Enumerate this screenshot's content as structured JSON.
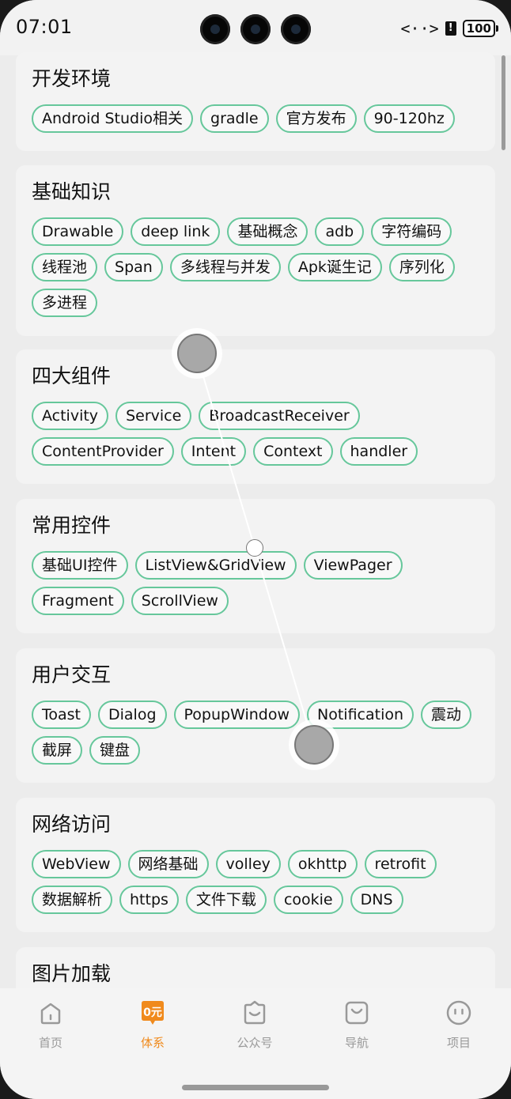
{
  "status_bar": {
    "time": "07:01",
    "battery": "100",
    "code_glyph": "<··>",
    "sim_glyph": "!"
  },
  "sections": [
    {
      "title": "开发环境",
      "tags": [
        "Android Studio相关",
        "gradle",
        "官方发布",
        "90-120hz"
      ]
    },
    {
      "title": "基础知识",
      "tags": [
        "Drawable",
        "deep link",
        "基础概念",
        "adb",
        "字符编码",
        "线程池",
        "Span",
        "多线程与并发",
        "Apk诞生记",
        "序列化",
        "多进程"
      ]
    },
    {
      "title": "四大组件",
      "tags": [
        "Activity",
        "Service",
        "BroadcastReceiver",
        "ContentProvider",
        "Intent",
        "Context",
        "handler"
      ]
    },
    {
      "title": "常用控件",
      "tags": [
        "基础UI控件",
        "ListView&GridView",
        "ViewPager",
        "Fragment",
        "ScrollView"
      ]
    },
    {
      "title": "用户交互",
      "tags": [
        "Toast",
        "Dialog",
        "PopupWindow",
        "Notification",
        "震动",
        "截屏",
        "键盘"
      ]
    },
    {
      "title": "网络访问",
      "tags": [
        "WebView",
        "网络基础",
        "volley",
        "okhttp",
        "retrofit",
        "数据解析",
        "https",
        "文件下载",
        "cookie",
        "DNS"
      ]
    },
    {
      "title": "图片加载",
      "tags": []
    }
  ],
  "nav": {
    "items": [
      {
        "label": "首页",
        "icon": "home-icon",
        "active": false
      },
      {
        "label": "体系",
        "icon": "system-icon",
        "active": true,
        "badge": "0元"
      },
      {
        "label": "公众号",
        "icon": "official-account-icon",
        "active": false
      },
      {
        "label": "导航",
        "icon": "navigation-bag-icon",
        "active": false
      },
      {
        "label": "项目",
        "icon": "project-face-icon",
        "active": false
      }
    ]
  },
  "colors": {
    "tag_border": "#66c79b",
    "active": "#f08a1c",
    "inactive": "#999999",
    "card_bg": "#f3f3f3",
    "page_bg": "#ececec"
  }
}
